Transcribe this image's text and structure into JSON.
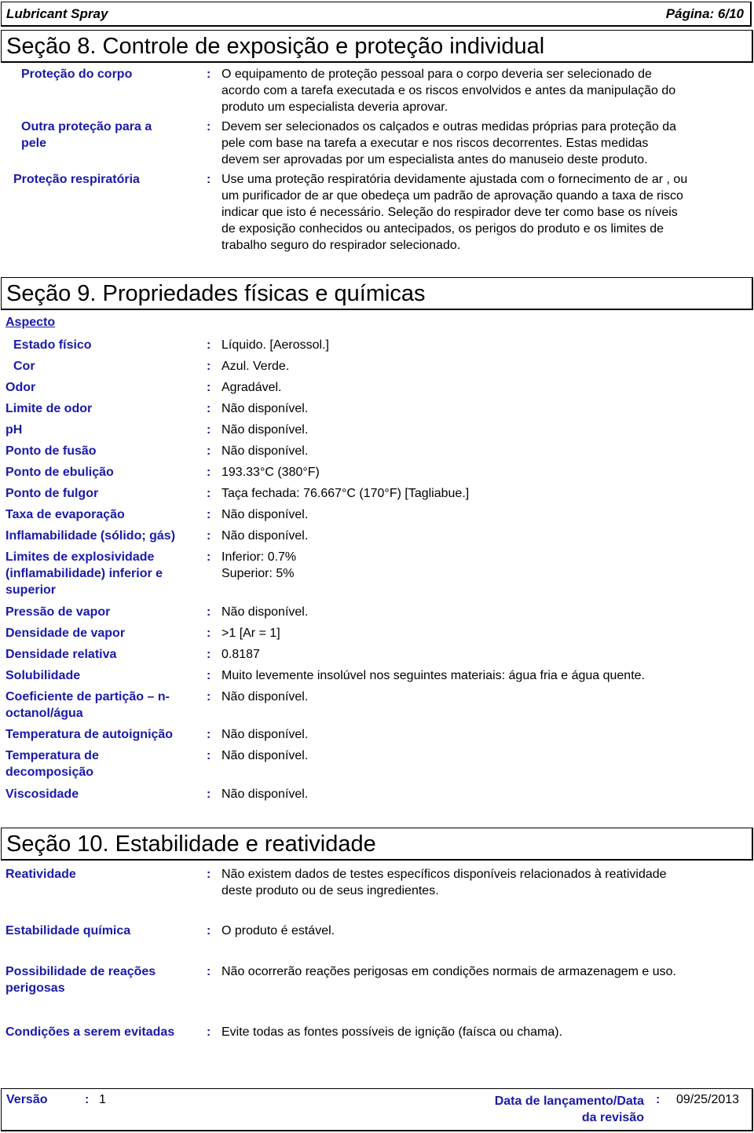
{
  "header": {
    "product_name": "Lubricant Spray",
    "page_label": "Página: 6/10"
  },
  "section8": {
    "title": "Seção 8. Controle de exposição e proteção individual",
    "rows": [
      {
        "label": "Proteção do corpo",
        "value_lines": [
          "O equipamento de proteção pessoal para o corpo deveria ser selecionado de",
          "acordo com a tarefa executada e os riscos envolvidos e antes da manipulação do",
          "produto um especialista deveria aprovar."
        ]
      },
      {
        "label_lines": [
          "Outra proteção para a",
          "pele"
        ],
        "value_lines": [
          "Devem ser selecionados os calçados e outras medidas próprias para proteção da",
          "pele com base na tarefa a executar e nos riscos decorrentes. Estas medidas",
          "devem ser aprovadas por um especialista antes do manuseio deste produto."
        ]
      },
      {
        "label": "Proteção respiratória",
        "value_lines": [
          "Use uma proteção respiratória devidamente ajustada com o fornecimento de ar , ou",
          "um purificador de ar que obedeça um padrão de aprovação quando a taxa de risco",
          "indicar que isto é necessário.  Seleção do respirador deve ter como base os níveis",
          "de exposição conhecidos ou antecipados, os perigos do produto e os limites de",
          "trabalho seguro do respirador selecionado."
        ]
      }
    ]
  },
  "section9": {
    "title": "Seção 9. Propriedades físicas e químicas",
    "aspect_heading": "Aspecto",
    "rows": [
      {
        "label": "Estado físico",
        "value": "Líquido. [Aerossol.]"
      },
      {
        "label": "Cor",
        "value": "Azul. Verde."
      },
      {
        "label": "Odor",
        "value": "Agradável."
      },
      {
        "label": "Limite de odor",
        "value": "Não disponível."
      },
      {
        "label": "pH",
        "value": "Não disponível."
      },
      {
        "label": "Ponto de fusão",
        "value": "Não disponível."
      },
      {
        "label": "Ponto de ebulição",
        "value": "193.33°C (380°F)"
      },
      {
        "label": "Ponto de fulgor",
        "value": "Taça fechada: 76.667°C (170°F) [Tagliabue.]"
      },
      {
        "label": "Taxa de evaporação",
        "value": "Não disponível."
      },
      {
        "label": "Inflamabilidade (sólido; gás)",
        "value": "Não disponível."
      },
      {
        "label_lines": [
          "Limites de explosividade",
          "(inflamabilidade) inferior e",
          "superior"
        ],
        "value_lines": [
          "Inferior: 0.7%",
          "Superior: 5%"
        ]
      },
      {
        "label": "Pressão de vapor",
        "value": "Não disponível."
      },
      {
        "label": "Densidade de vapor",
        "value": ">1 [Ar = 1]"
      },
      {
        "label": "Densidade relativa",
        "value": "0.8187"
      },
      {
        "label": "Solubilidade",
        "value": "Muito levemente insolúvel nos seguintes materiais: água fria e água quente."
      },
      {
        "label_lines": [
          "Coeficiente de partição – n-",
          "octanol/água"
        ],
        "value": "Não disponível."
      },
      {
        "label": "Temperatura de autoignição",
        "value": "Não disponível."
      },
      {
        "label_lines": [
          "Temperatura de",
          "decomposição"
        ],
        "value": "Não disponível."
      },
      {
        "label": "Viscosidade",
        "value": "Não disponível."
      }
    ]
  },
  "section10": {
    "title": "Seção 10. Estabilidade e reatividade",
    "rows": [
      {
        "label": "Reatividade",
        "value_lines": [
          "Não existem dados de testes específicos disponíveis relacionados à reatividade",
          "deste produto ou de seus ingredientes."
        ]
      },
      {
        "label": "Estabilidade química",
        "value": "O produto é estável."
      },
      {
        "label_lines": [
          "Possibilidade de reações",
          "perigosas"
        ],
        "value": "Não ocorrerão reações perigosas em condições normais de armazenagem e uso."
      },
      {
        "label": "Condições a serem evitadas",
        "value": "Evite todas as fontes possíveis de ignição (faísca ou chama)."
      }
    ]
  },
  "footer": {
    "version_label": "Versão",
    "version_value": "1",
    "date_label_lines": [
      "Data de lançamento/Data",
      "da revisão"
    ],
    "date_value": "09/25/2013"
  },
  "colon": ":"
}
